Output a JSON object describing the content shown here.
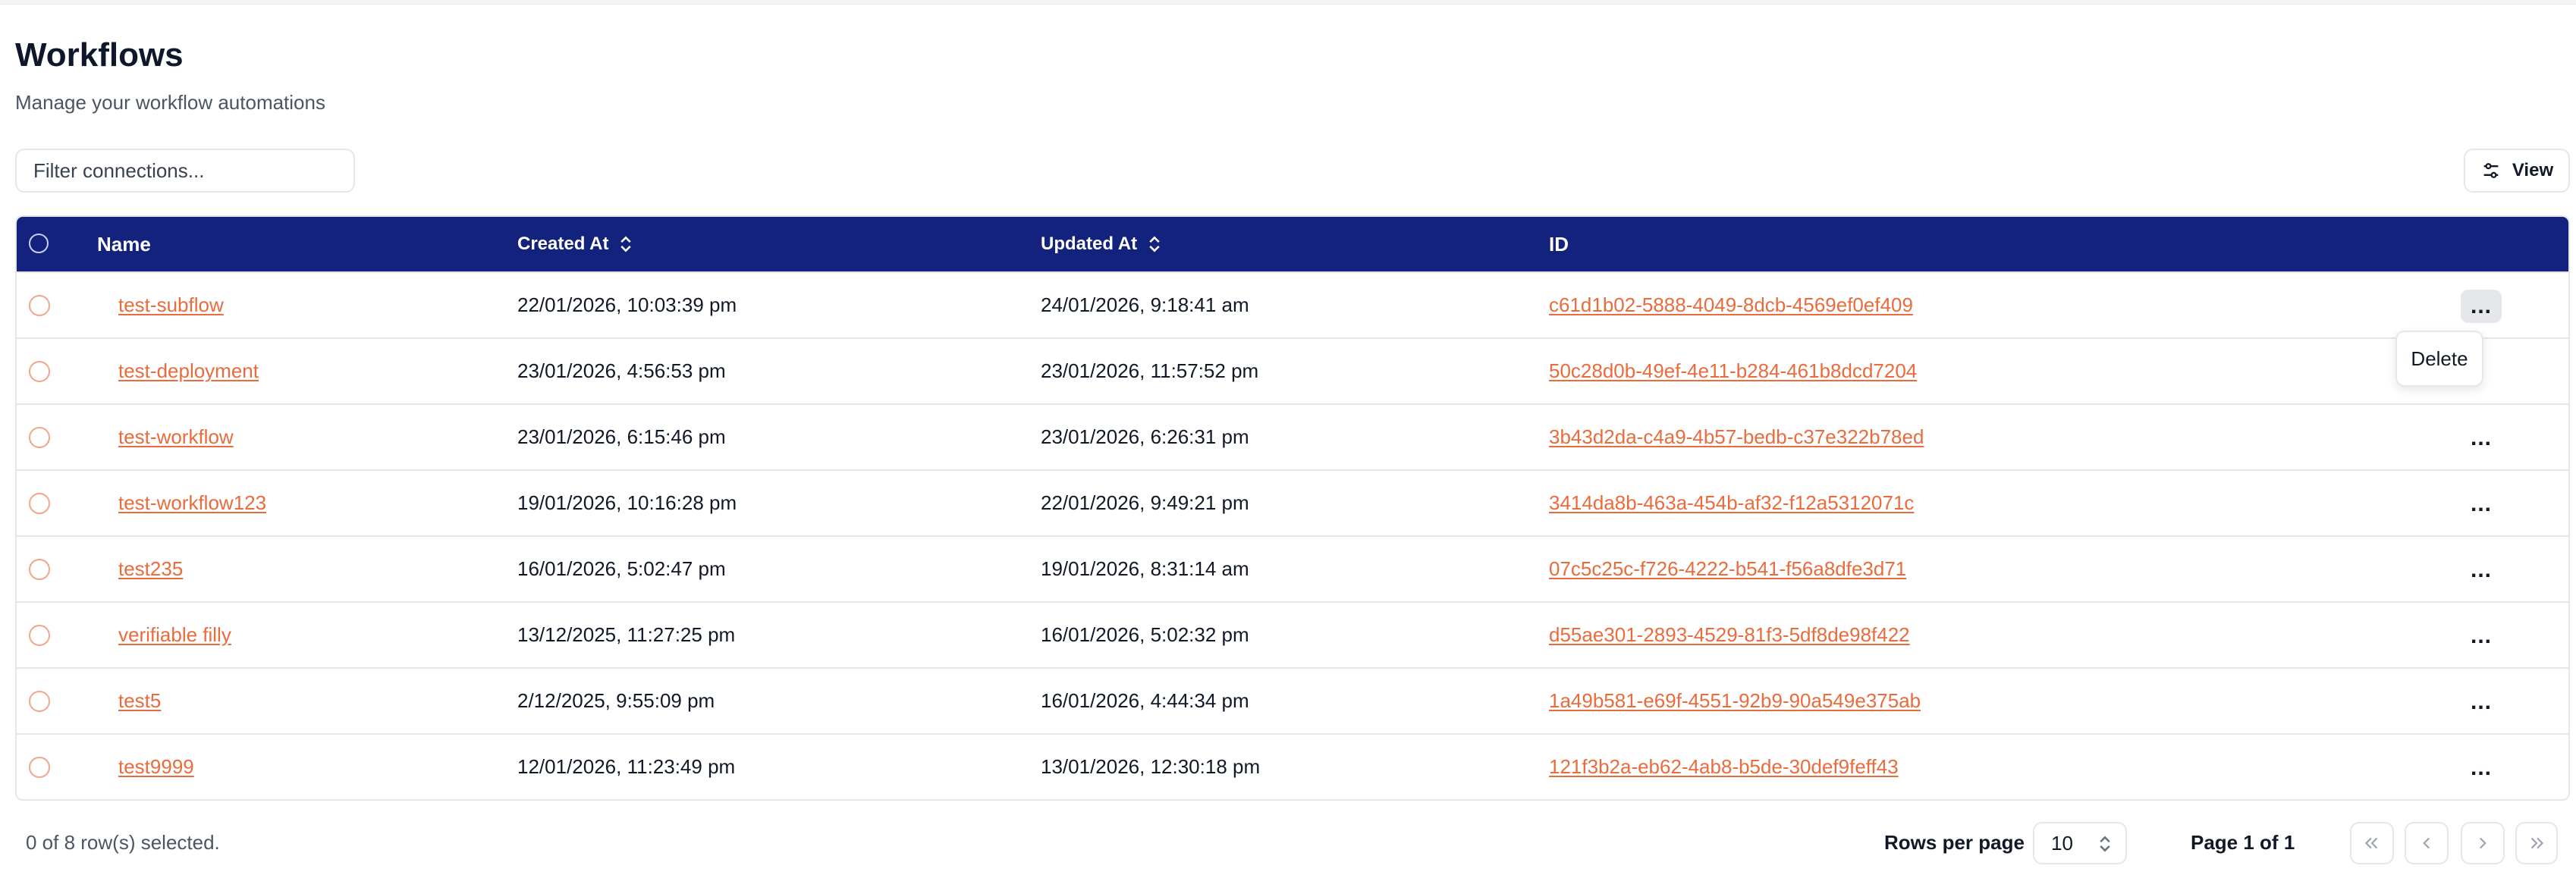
{
  "header": {
    "title": "Workflows",
    "subtitle": "Manage your workflow automations"
  },
  "toolbar": {
    "filter_placeholder": "Filter connections...",
    "view_label": "View"
  },
  "table": {
    "columns": {
      "name": "Name",
      "created_at": "Created At",
      "updated_at": "Updated At",
      "id": "ID"
    },
    "rows": [
      {
        "name": "test-subflow",
        "created": "22/01/2026, 10:03:39 pm",
        "updated": "24/01/2026, 9:18:41 am",
        "id": "c61d1b02-5888-4049-8dcb-4569ef0ef409"
      },
      {
        "name": "test-deployment",
        "created": "23/01/2026, 4:56:53 pm",
        "updated": "23/01/2026, 11:57:52 pm",
        "id": "50c28d0b-49ef-4e11-b284-461b8dcd7204"
      },
      {
        "name": "test-workflow",
        "created": "23/01/2026, 6:15:46 pm",
        "updated": "23/01/2026, 6:26:31 pm",
        "id": "3b43d2da-c4a9-4b57-bedb-c37e322b78ed"
      },
      {
        "name": "test-workflow123",
        "created": "19/01/2026, 10:16:28 pm",
        "updated": "22/01/2026, 9:49:21 pm",
        "id": "3414da8b-463a-454b-af32-f12a5312071c"
      },
      {
        "name": "test235",
        "created": "16/01/2026, 5:02:47 pm",
        "updated": "19/01/2026, 8:31:14 am",
        "id": "07c5c25c-f726-4222-b541-f56a8dfe3d71"
      },
      {
        "name": "verifiable filly",
        "created": "13/12/2025, 11:27:25 pm",
        "updated": "16/01/2026, 5:02:32 pm",
        "id": "d55ae301-2893-4529-81f3-5df8de98f422"
      },
      {
        "name": "test5",
        "created": "2/12/2025, 9:55:09 pm",
        "updated": "16/01/2026, 4:44:34 pm",
        "id": "1a49b581-e69f-4551-92b9-90a549e375ab"
      },
      {
        "name": "test9999",
        "created": "12/01/2026, 11:23:49 pm",
        "updated": "13/01/2026, 12:30:18 pm",
        "id": "121f3b2a-eb62-4ab8-b5de-30def9feff43"
      }
    ],
    "row_actions_label": "...",
    "menu": {
      "delete_label": "Delete"
    }
  },
  "footer": {
    "selection_text": "0 of 8 row(s) selected.",
    "rows_per_page_label": "Rows per page",
    "rows_per_page_value": "10",
    "page_text": "Page 1 of 1"
  },
  "colors": {
    "header_bg": "#13227d",
    "link": "#ea6b3c"
  },
  "icons": {
    "view": "sliders-icon",
    "sort": "chevrons-up-down-icon",
    "first": "chevrons-left-icon",
    "prev": "chevron-left-icon",
    "next": "chevron-right-icon",
    "last": "chevrons-right-icon"
  }
}
